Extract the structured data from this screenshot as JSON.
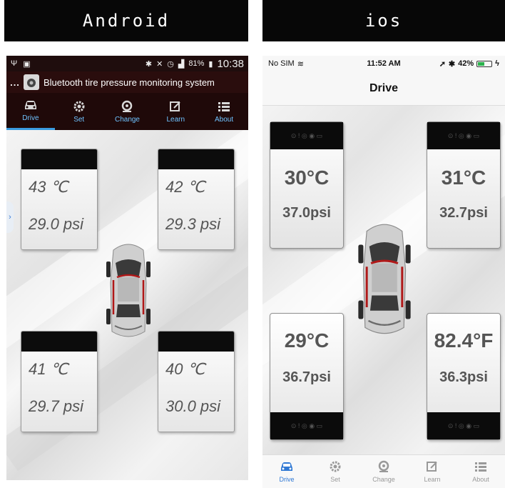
{
  "android": {
    "platform_title": "Android",
    "status_bar": {
      "left_icons": [
        "usb-icon",
        "image-icon"
      ],
      "right_icons": [
        "bluetooth-icon",
        "mute-icon",
        "alarm-icon",
        "signal-icon"
      ],
      "battery": "81%",
      "time": "10:38"
    },
    "app_title": "Bluetooth tire pressure monitoring system",
    "menu_dots": "...",
    "tabs": [
      {
        "label": "Drive",
        "icon": "car-icon",
        "active": true
      },
      {
        "label": "Set",
        "icon": "gear-icon",
        "active": false
      },
      {
        "label": "Change",
        "icon": "tire-icon",
        "active": false
      },
      {
        "label": "Learn",
        "icon": "edit-icon",
        "active": false
      },
      {
        "label": "About",
        "icon": "list-icon",
        "active": false
      }
    ],
    "side_arrow": "›",
    "tires": {
      "front_left": {
        "temp": "43 ℃",
        "pressure": "29.0 psi"
      },
      "front_right": {
        "temp": "42 ℃",
        "pressure": "29.3 psi"
      },
      "rear_left": {
        "temp": "41 ℃",
        "pressure": "29.7 psi"
      },
      "rear_right": {
        "temp": "40 ℃",
        "pressure": "30.0 psi"
      }
    }
  },
  "ios": {
    "platform_title": "ios",
    "status_bar": {
      "carrier": "No SIM",
      "time": "11:52 AM",
      "battery": "42%"
    },
    "nav_title": "Drive",
    "tires": {
      "front_left": {
        "temp": "30°C",
        "pressure": "37.0psi"
      },
      "front_right": {
        "temp": "31°C",
        "pressure": "32.7psi"
      },
      "rear_left": {
        "temp": "29°C",
        "pressure": "36.7psi"
      },
      "rear_right": {
        "temp": "82.4°F",
        "pressure": "36.3psi"
      }
    },
    "tabs": [
      {
        "label": "Drive",
        "icon": "car-icon",
        "active": true
      },
      {
        "label": "Set",
        "icon": "gear-icon",
        "active": false
      },
      {
        "label": "Change",
        "icon": "tire-icon",
        "active": false
      },
      {
        "label": "Learn",
        "icon": "edit-icon",
        "active": false
      },
      {
        "label": "About",
        "icon": "list-icon",
        "active": false
      }
    ]
  },
  "colors": {
    "android_bar": "#1f0909",
    "android_tab_text": "#6fc3ff",
    "ios_active": "#2f78d4",
    "card_band": "#0b0b0b",
    "car_body": "#c9c9c9",
    "car_accent": "#b01818"
  }
}
